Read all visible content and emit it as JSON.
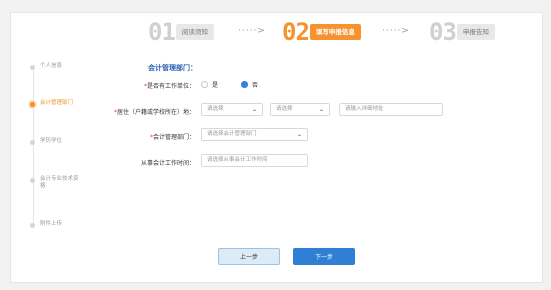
{
  "steps": [
    {
      "num": "01",
      "label": "阅读须知",
      "active": false
    },
    {
      "num": "02",
      "label": "填写申报信息",
      "active": true
    },
    {
      "num": "03",
      "label": "申报告知",
      "active": false
    }
  ],
  "step_arrow": "·····>",
  "sidebar": {
    "items": [
      {
        "label": "个人信息"
      },
      {
        "label": "会计管理部门",
        "active": true
      },
      {
        "label": "学历学位"
      },
      {
        "label": "会计专业技术资格"
      },
      {
        "label": "附件上传"
      }
    ]
  },
  "form": {
    "section_title": "会计管理部门：",
    "has_unit": {
      "label": "是否有工作单位：",
      "options": [
        "是",
        "否"
      ],
      "selected": "否"
    },
    "residence": {
      "label": "居住（户籍或学校所在）地：",
      "select1_placeholder": "请选择",
      "select2_placeholder": "请选择",
      "address_placeholder": "请输入详细地址"
    },
    "dept": {
      "label": "会计管理部门：",
      "placeholder": "请选择会计管理部门"
    },
    "work_time": {
      "label": "从事会计工作时间：",
      "placeholder": "请选择从事会计工作时间"
    }
  },
  "buttons": {
    "prev": "上一步",
    "next": "下一步"
  },
  "colors": {
    "accent_orange": "#f6932e",
    "primary_blue": "#2f7fd4",
    "required_red": "#e23b3b"
  }
}
